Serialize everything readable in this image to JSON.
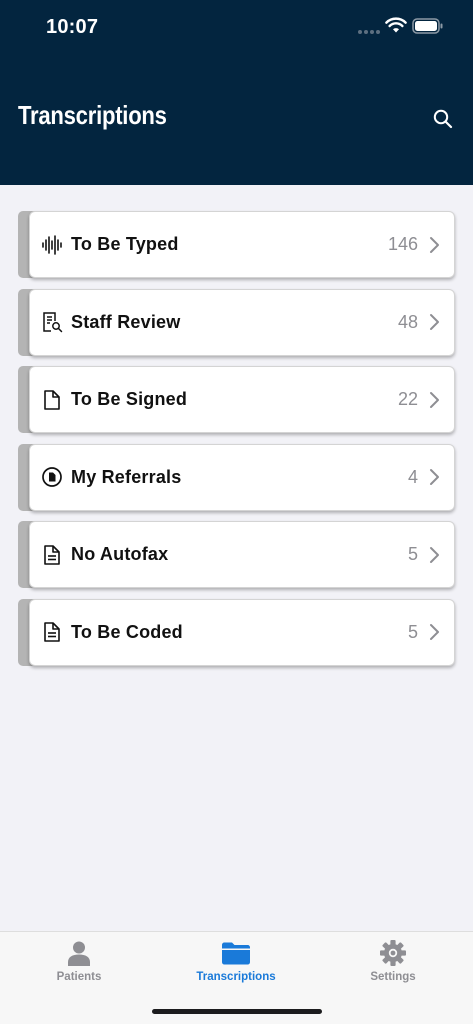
{
  "status_bar": {
    "time": "10:07"
  },
  "header": {
    "title": "Transcriptions",
    "background": "#03253f"
  },
  "list": {
    "items": [
      {
        "label": "To Be Typed",
        "count": "146",
        "icon": "waveform-icon"
      },
      {
        "label": "Staff Review",
        "count": "48",
        "icon": "document-search-icon"
      },
      {
        "label": "To Be Signed",
        "count": "22",
        "icon": "document-icon"
      },
      {
        "label": "My Referrals",
        "count": "4",
        "icon": "referral-badge-icon"
      },
      {
        "label": "No Autofax",
        "count": "5",
        "icon": "document-lines-icon"
      },
      {
        "label": "To Be Coded",
        "count": "5",
        "icon": "document-lines-icon"
      }
    ]
  },
  "tabbar": {
    "tabs": [
      {
        "label": "Patients",
        "icon": "person-icon",
        "active": false
      },
      {
        "label": "Transcriptions",
        "icon": "folder-icon",
        "active": true
      },
      {
        "label": "Settings",
        "icon": "gear-icon",
        "active": false
      }
    ],
    "accent": "#1a7ad9"
  }
}
